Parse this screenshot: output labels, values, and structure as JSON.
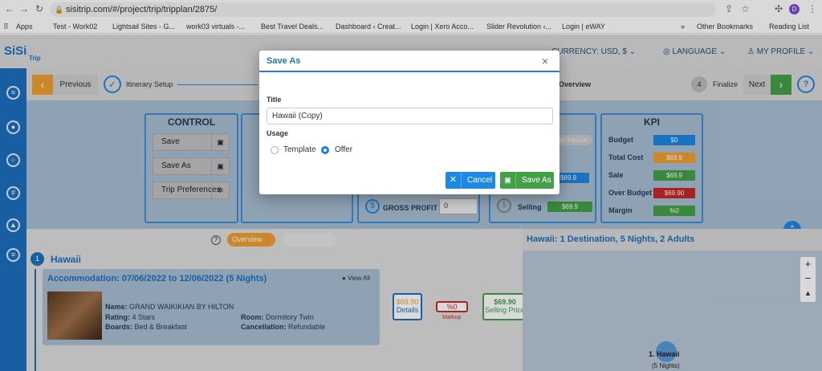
{
  "browser": {
    "url": "sisitrip.com/#/project/trip/tripplan/2875/",
    "profile_initial": "D",
    "bookmarks": [
      "Apps",
      "Test - Work02",
      "Lightsail Sites - G...",
      "work03 virtuals -...",
      "Best Travel Deals...",
      "Dashboard ‹ Creat...",
      "Login | Xero Acco...",
      "Slider Revolution ‹...",
      "Login | eWAY",
      "»",
      "Other Bookmarks",
      "Reading List"
    ]
  },
  "app": {
    "logo": "SiSi",
    "logo_sub": "Trip",
    "currency": "CURRENCY: USD, $",
    "language": "LANGUAGE",
    "profile": "MY PROFILE"
  },
  "wizard": {
    "previous": "Previous",
    "step1": "Itinerary Setup",
    "overview": "Overview",
    "step4_num": "4",
    "step4": "Finalize",
    "next": "Next",
    "help": "?"
  },
  "control": {
    "title": "CONTROL",
    "save": "Save",
    "save_as": "Save As",
    "trip_preferences": "Trip Preferences"
  },
  "kpi": {
    "title": "KPI",
    "rows": [
      {
        "label": "Budget",
        "value": "$0",
        "color": "#1e88e5"
      },
      {
        "label": "Total Cost",
        "value": "$69.9",
        "color": "#f0a030"
      },
      {
        "label": "Sale",
        "value": "$69.9",
        "color": "#43a047"
      },
      {
        "label": "Over Budget",
        "value": "$69.90",
        "color": "#c62828"
      },
      {
        "label": "Margin",
        "value": "%0",
        "color": "#43a047"
      }
    ]
  },
  "pricing": {
    "per_person": "Per Person",
    "cost_value": "$69.9",
    "selling_label": "Selling",
    "selling_value": "$69.9",
    "gross_profit": "GROSS PROFIT",
    "gross_value": "0"
  },
  "lower": {
    "toggle_label": "Overview",
    "destination_num": "1",
    "destination": "Hawaii",
    "accommodation_title": "Accommodation: 07/06/2022 to 12/06/2022 (5 Nights)",
    "view_all": "View All",
    "name_label": "Name:",
    "name_value": "GRAND WAIKIKIAN BY HILTON",
    "rating_label": "Rating:",
    "rating_value": "4 Stars",
    "room_label": "Room:",
    "room_value": "Dormitory Twin",
    "boards_label": "Boards:",
    "boards_value": "Bed & Breakfast",
    "cancel_label": "Cancellation:",
    "cancel_value": "Refundable",
    "details_price": "$69.90",
    "details": "Details",
    "markup_value": "%0",
    "markup": "Markup",
    "selling_price_value": "$69.90",
    "selling_price": "Selling Price"
  },
  "map": {
    "title": "Hawaii: 1 Destination, 5 Nights, 2 Adults",
    "pin_label": "1. Hawaii",
    "pin_sub": "(5 Nights)",
    "zoom_in": "+",
    "zoom_out": "−"
  },
  "modal": {
    "title": "Save As",
    "close": "×",
    "title_label": "Title",
    "title_value": "Hawaii (Copy)",
    "usage_label": "Usage",
    "opt_template": "Template",
    "opt_offer": "Offer",
    "selected": "Offer",
    "cancel": "Cancel",
    "save_as": "Save As"
  }
}
